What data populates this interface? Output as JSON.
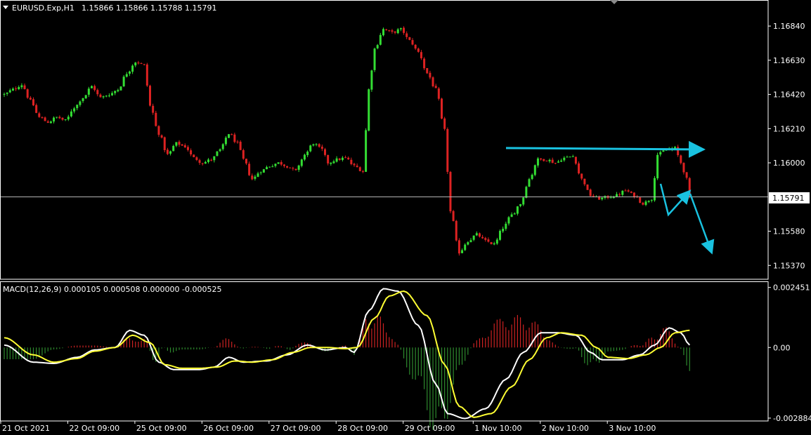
{
  "window": {
    "symbol_header": "EURUSD.Exp,H1",
    "ohlc": "1.15866 1.15866 1.15788 1.15791",
    "current_price_label": "1.15791"
  },
  "indicator": {
    "header": "MACD(12,26,9) 0.000105 0.000508 0.000000 -0.000525"
  },
  "colors": {
    "background": "#000000",
    "frame": "#ffffff",
    "bull_candle": "#33dd33",
    "bear_candle": "#dd2222",
    "bid_line": "#b8b8b8",
    "annotation": "#19c2e0",
    "macd_line": "#ffffff",
    "signal_line": "#ffff33",
    "hist_positive": "#cc2222",
    "hist_negative": "#2e8b2e"
  },
  "chart_data": [
    {
      "type": "candlestick",
      "symbol": "EURUSD.Exp",
      "timeframe": "H1",
      "ylim": [
        1.15285,
        1.17
      ],
      "y_ticks": [
        "1.16840",
        "1.16630",
        "1.16420",
        "1.16210",
        "1.16000",
        "1.15580",
        "1.15370"
      ],
      "x_ticks": [
        "21 Oct 2021",
        "22 Oct 09:00",
        "25 Oct 09:00",
        "26 Oct 09:00",
        "27 Oct 09:00",
        "28 Oct 09:00",
        "29 Oct 09:00",
        "1 Nov 10:00",
        "2 Nov 10:00",
        "3 Nov 10:00"
      ],
      "current_price": 1.15791,
      "close_path": [
        [
          0,
          1.1642
        ],
        [
          3,
          1.1645
        ],
        [
          6,
          1.1648
        ],
        [
          9,
          1.1638
        ],
        [
          12,
          1.1628
        ],
        [
          15,
          1.1625
        ],
        [
          18,
          1.1628
        ],
        [
          21,
          1.1626
        ],
        [
          24,
          1.1634
        ],
        [
          27,
          1.164
        ],
        [
          30,
          1.1647
        ],
        [
          33,
          1.164
        ],
        [
          36,
          1.1642
        ],
        [
          39,
          1.1645
        ],
        [
          42,
          1.1655
        ],
        [
          45,
          1.1662
        ],
        [
          48,
          1.166
        ],
        [
          50,
          1.1635
        ],
        [
          53,
          1.1618
        ],
        [
          56,
          1.1605
        ],
        [
          59,
          1.1612
        ],
        [
          62,
          1.161
        ],
        [
          65,
          1.1603
        ],
        [
          68,
          1.16
        ],
        [
          71,
          1.1602
        ],
        [
          74,
          1.1608
        ],
        [
          77,
          1.1618
        ],
        [
          80,
          1.1612
        ],
        [
          82,
          1.1602
        ],
        [
          85,
          1.159
        ],
        [
          88,
          1.1595
        ],
        [
          91,
          1.1598
        ],
        [
          94,
          1.16
        ],
        [
          97,
          1.1598
        ],
        [
          100,
          1.1595
        ],
        [
          103,
          1.1605
        ],
        [
          106,
          1.1612
        ],
        [
          109,
          1.1608
        ],
        [
          111,
          1.16
        ],
        [
          114,
          1.1602
        ],
        [
          117,
          1.1603
        ],
        [
          120,
          1.1598
        ],
        [
          123,
          1.1595
        ],
        [
          125,
          1.1645
        ],
        [
          127,
          1.167
        ],
        [
          130,
          1.1682
        ],
        [
          133,
          1.168
        ],
        [
          136,
          1.1682
        ],
        [
          139,
          1.1675
        ],
        [
          142,
          1.1668
        ],
        [
          145,
          1.1655
        ],
        [
          148,
          1.1645
        ],
        [
          151,
          1.162
        ],
        [
          153,
          1.157
        ],
        [
          156,
          1.1545
        ],
        [
          159,
          1.1552
        ],
        [
          162,
          1.1556
        ],
        [
          165,
          1.1552
        ],
        [
          168,
          1.155
        ],
        [
          171,
          1.156
        ],
        [
          174,
          1.1568
        ],
        [
          177,
          1.1575
        ],
        [
          180,
          1.159
        ],
        [
          183,
          1.1602
        ],
        [
          186,
          1.1602
        ],
        [
          189,
          1.16
        ],
        [
          192,
          1.1603
        ],
        [
          195,
          1.1604
        ],
        [
          198,
          1.159
        ],
        [
          201,
          1.158
        ],
        [
          204,
          1.1578
        ],
        [
          207,
          1.1579
        ],
        [
          210,
          1.158
        ],
        [
          213,
          1.1583
        ],
        [
          216,
          1.158
        ],
        [
          219,
          1.1575
        ],
        [
          222,
          1.1578
        ],
        [
          224,
          1.1605
        ],
        [
          227,
          1.1608
        ],
        [
          230,
          1.1609
        ],
        [
          232,
          1.16
        ],
        [
          234,
          1.159
        ],
        [
          235,
          1.1581
        ]
      ]
    },
    {
      "type": "line",
      "indicator": "MACD",
      "params": [
        12,
        26,
        9
      ],
      "ylim": [
        -0.003,
        0.0027
      ],
      "y_ticks": [
        "0.002451",
        "0.00",
        "-0.002884"
      ],
      "series": [
        {
          "role": "macd",
          "path": [
            [
              0,
              0.0001
            ],
            [
              10,
              -0.0006
            ],
            [
              17,
              -0.00065
            ],
            [
              25,
              -0.0004
            ],
            [
              31,
              -0.0001
            ],
            [
              38,
              0.0
            ],
            [
              43,
              0.0007
            ],
            [
              48,
              0.0005
            ],
            [
              53,
              -0.0006
            ],
            [
              58,
              -0.0009
            ],
            [
              67,
              -0.0009
            ],
            [
              72,
              -0.0008
            ],
            [
              77,
              -0.0004
            ],
            [
              82,
              -0.0006
            ],
            [
              90,
              -0.00055
            ],
            [
              97,
              -0.0003
            ],
            [
              104,
              0.0001
            ],
            [
              110,
              -0.0001
            ],
            [
              117,
              0.0
            ],
            [
              120,
              -0.0002
            ],
            [
              125,
              0.0015
            ],
            [
              130,
              0.0024
            ],
            [
              135,
              0.0023
            ],
            [
              142,
              0.0009
            ],
            [
              148,
              -0.0015
            ],
            [
              152,
              -0.0027
            ],
            [
              158,
              -0.0029
            ],
            [
              165,
              -0.0025
            ],
            [
              172,
              -0.0013
            ],
            [
              178,
              -0.0002
            ],
            [
              184,
              0.0006
            ],
            [
              190,
              0.0006
            ],
            [
              196,
              0.0005
            ],
            [
              201,
              -0.0002
            ],
            [
              205,
              -0.0005
            ],
            [
              212,
              -0.0005
            ],
            [
              218,
              -0.0003
            ],
            [
              223,
              0.0001
            ],
            [
              228,
              0.0008
            ],
            [
              232,
              0.0006
            ],
            [
              235,
              0.0001
            ]
          ]
        },
        {
          "role": "signal",
          "path": [
            [
              0,
              0.0004
            ],
            [
              10,
              -0.0003
            ],
            [
              17,
              -0.0006
            ],
            [
              25,
              -0.00045
            ],
            [
              31,
              -0.00015
            ],
            [
              38,
              0.0
            ],
            [
              44,
              0.0005
            ],
            [
              50,
              0.0002
            ],
            [
              55,
              -0.0007
            ],
            [
              61,
              -0.00085
            ],
            [
              67,
              -0.00085
            ],
            [
              73,
              -0.0008
            ],
            [
              79,
              -0.00055
            ],
            [
              85,
              -0.0006
            ],
            [
              92,
              -0.0005
            ],
            [
              99,
              -0.0002
            ],
            [
              105,
              0.0
            ],
            [
              111,
              0.0
            ],
            [
              117,
              -5e-05
            ],
            [
              121,
              0.0
            ],
            [
              127,
              0.0012
            ],
            [
              132,
              0.0021
            ],
            [
              137,
              0.0023
            ],
            [
              145,
              0.0013
            ],
            [
              151,
              -0.0007
            ],
            [
              156,
              -0.0024
            ],
            [
              161,
              -0.00285
            ],
            [
              167,
              -0.0027
            ],
            [
              174,
              -0.0016
            ],
            [
              180,
              -0.0005
            ],
            [
              186,
              0.0004
            ],
            [
              191,
              0.0006
            ],
            [
              198,
              0.0005
            ],
            [
              203,
              0.0
            ],
            [
              207,
              -0.0004
            ],
            [
              214,
              -0.00045
            ],
            [
              220,
              -0.0003
            ],
            [
              225,
              0.0
            ],
            [
              230,
              0.0006
            ],
            [
              235,
              0.0007
            ]
          ]
        }
      ]
    }
  ]
}
